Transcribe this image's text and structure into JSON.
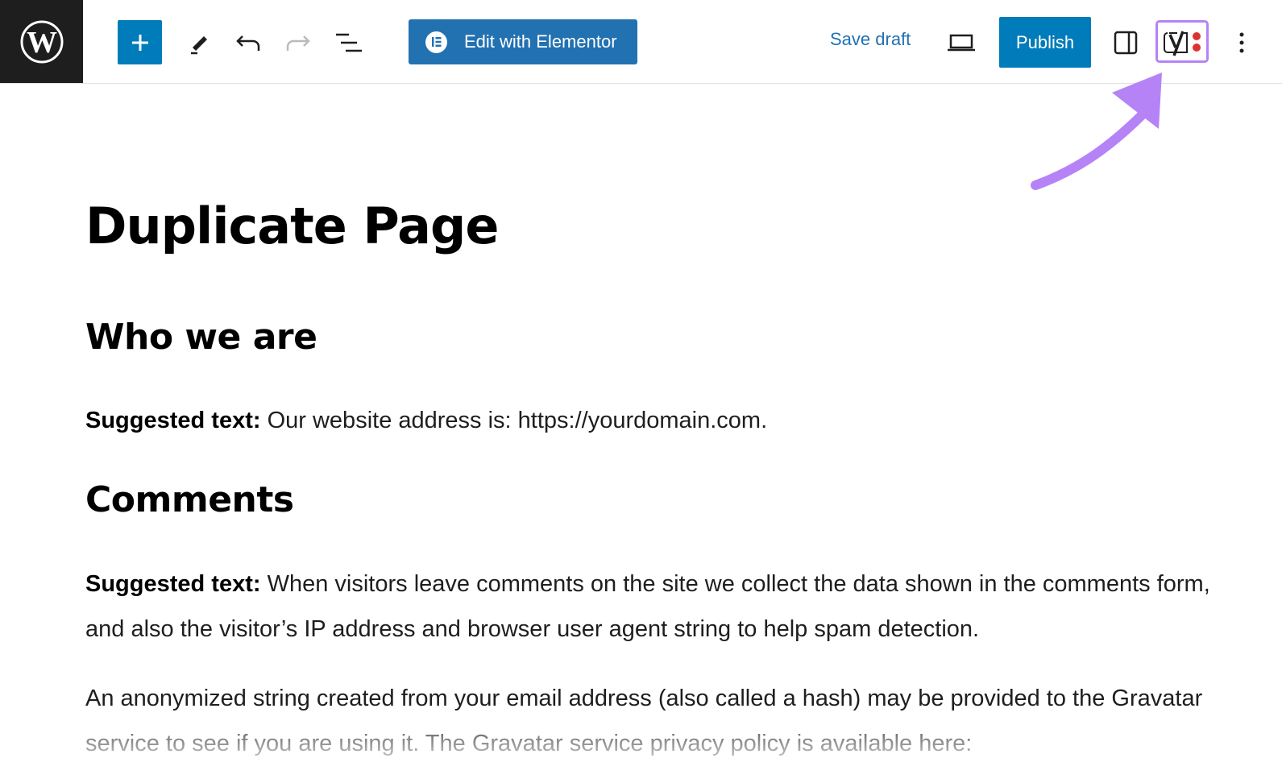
{
  "toolbar": {
    "add_block_label": "+",
    "elementor_label": "Edit with Elementor",
    "save_draft_label": "Save draft",
    "publish_label": "Publish",
    "icons": [
      "wordpress-logo-icon",
      "plus-icon",
      "pencil-icon",
      "undo-icon",
      "redo-icon",
      "document-overview-icon",
      "elementor-icon",
      "desktop-preview-icon",
      "sidebar-toggle-icon",
      "yoast-seo-icon",
      "more-options-icon"
    ],
    "highlight_color": "#b683f7",
    "primary_color": "#007cba"
  },
  "content": {
    "title": "Duplicate Page",
    "sections": [
      {
        "heading": "Who we are",
        "paragraphs": [
          {
            "bold": "Suggested text:",
            "text": " Our website address is: https://yourdomain.com."
          }
        ]
      },
      {
        "heading": "Comments",
        "paragraphs": [
          {
            "bold": "Suggested text:",
            "text": " When visitors leave comments on the site we collect the data shown in the comments form, and also the visitor’s IP address and browser user agent string to help spam detection."
          },
          {
            "bold": "",
            "text": "An anonymized string created from your email address (also called a hash) may be provided to the Gravatar service to see if you are using it. The Gravatar service privacy policy is available here:"
          }
        ]
      }
    ]
  }
}
